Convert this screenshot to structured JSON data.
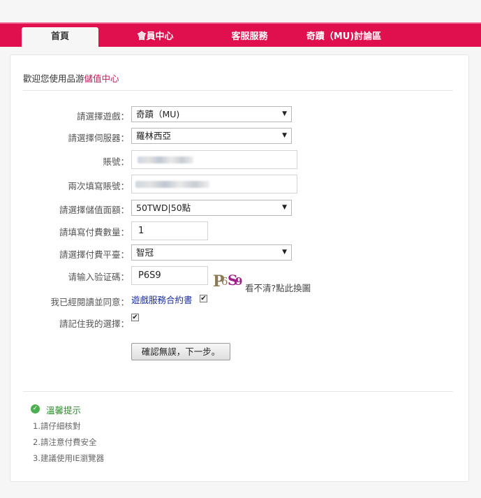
{
  "nav": {
    "tabs": [
      {
        "label": "首頁"
      },
      {
        "label": "會員中心"
      },
      {
        "label": "客服服務"
      },
      {
        "label": "奇蹟（MU)討論區"
      }
    ]
  },
  "welcome": {
    "prefix": "歡迎您使用品游",
    "highlight": "儲值中心"
  },
  "form": {
    "game_label": "請選擇遊戲：",
    "game_value": "奇蹟（MU)",
    "server_label": "請選擇伺服器：",
    "server_value": "羅林西亞",
    "account_label": "賬號：",
    "account_confirm_label": "兩次填寫賬號：",
    "amount_label": "請選擇儲值面額：",
    "amount_value": "50TWD|50點",
    "quantity_label": "請填寫付費數量：",
    "quantity_value": "1",
    "platform_label": "請選擇付費平臺：",
    "platform_value": "智冠",
    "captcha_label": "请输入验证碼：",
    "captcha_value": "P6S9",
    "captcha_image_text": "P6S9",
    "captcha_refresh": "看不清?點此換圖",
    "agree_label": "我已經閱讀並同意：",
    "agree_link": "遊戲服務合約書",
    "remember_label": "請記住我的選擇：",
    "submit_label": "確認無誤，下一步。"
  },
  "tips": {
    "title": "溫馨提示",
    "items": [
      "1.請仔細核對",
      "2.請注意付費安全",
      "3.建議使用IE瀏覽器"
    ]
  },
  "colors": {
    "topbar": "#e0104f",
    "highlight": "#c0185a",
    "tips_title": "#2e8b2e",
    "link": "#1a2fa0"
  }
}
